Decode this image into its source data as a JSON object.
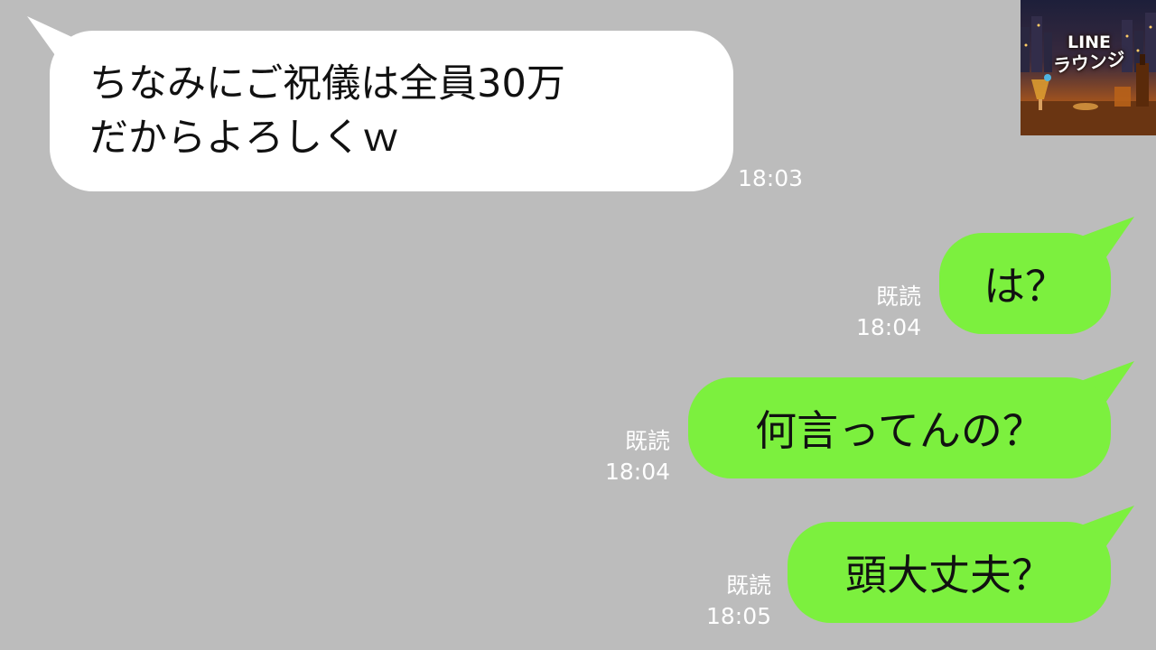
{
  "logo": {
    "line1": "LINE",
    "line2": "ラウンジ"
  },
  "messages": [
    {
      "text": "ちなみにご祝儀は全員30万\nだからよろしくｗ",
      "time": "18:03"
    },
    {
      "text": "は？",
      "read": "既読",
      "time": "18:04"
    },
    {
      "text": "何言ってんの？",
      "read": "既読",
      "time": "18:04"
    },
    {
      "text": "頭大丈夫？",
      "read": "既読",
      "time": "18:05"
    }
  ],
  "colors": {
    "background": "#bcbcbc",
    "incoming_bubble": "#ffffff",
    "outgoing_bubble": "#7cf03e",
    "meta_text": "#ffffff"
  }
}
